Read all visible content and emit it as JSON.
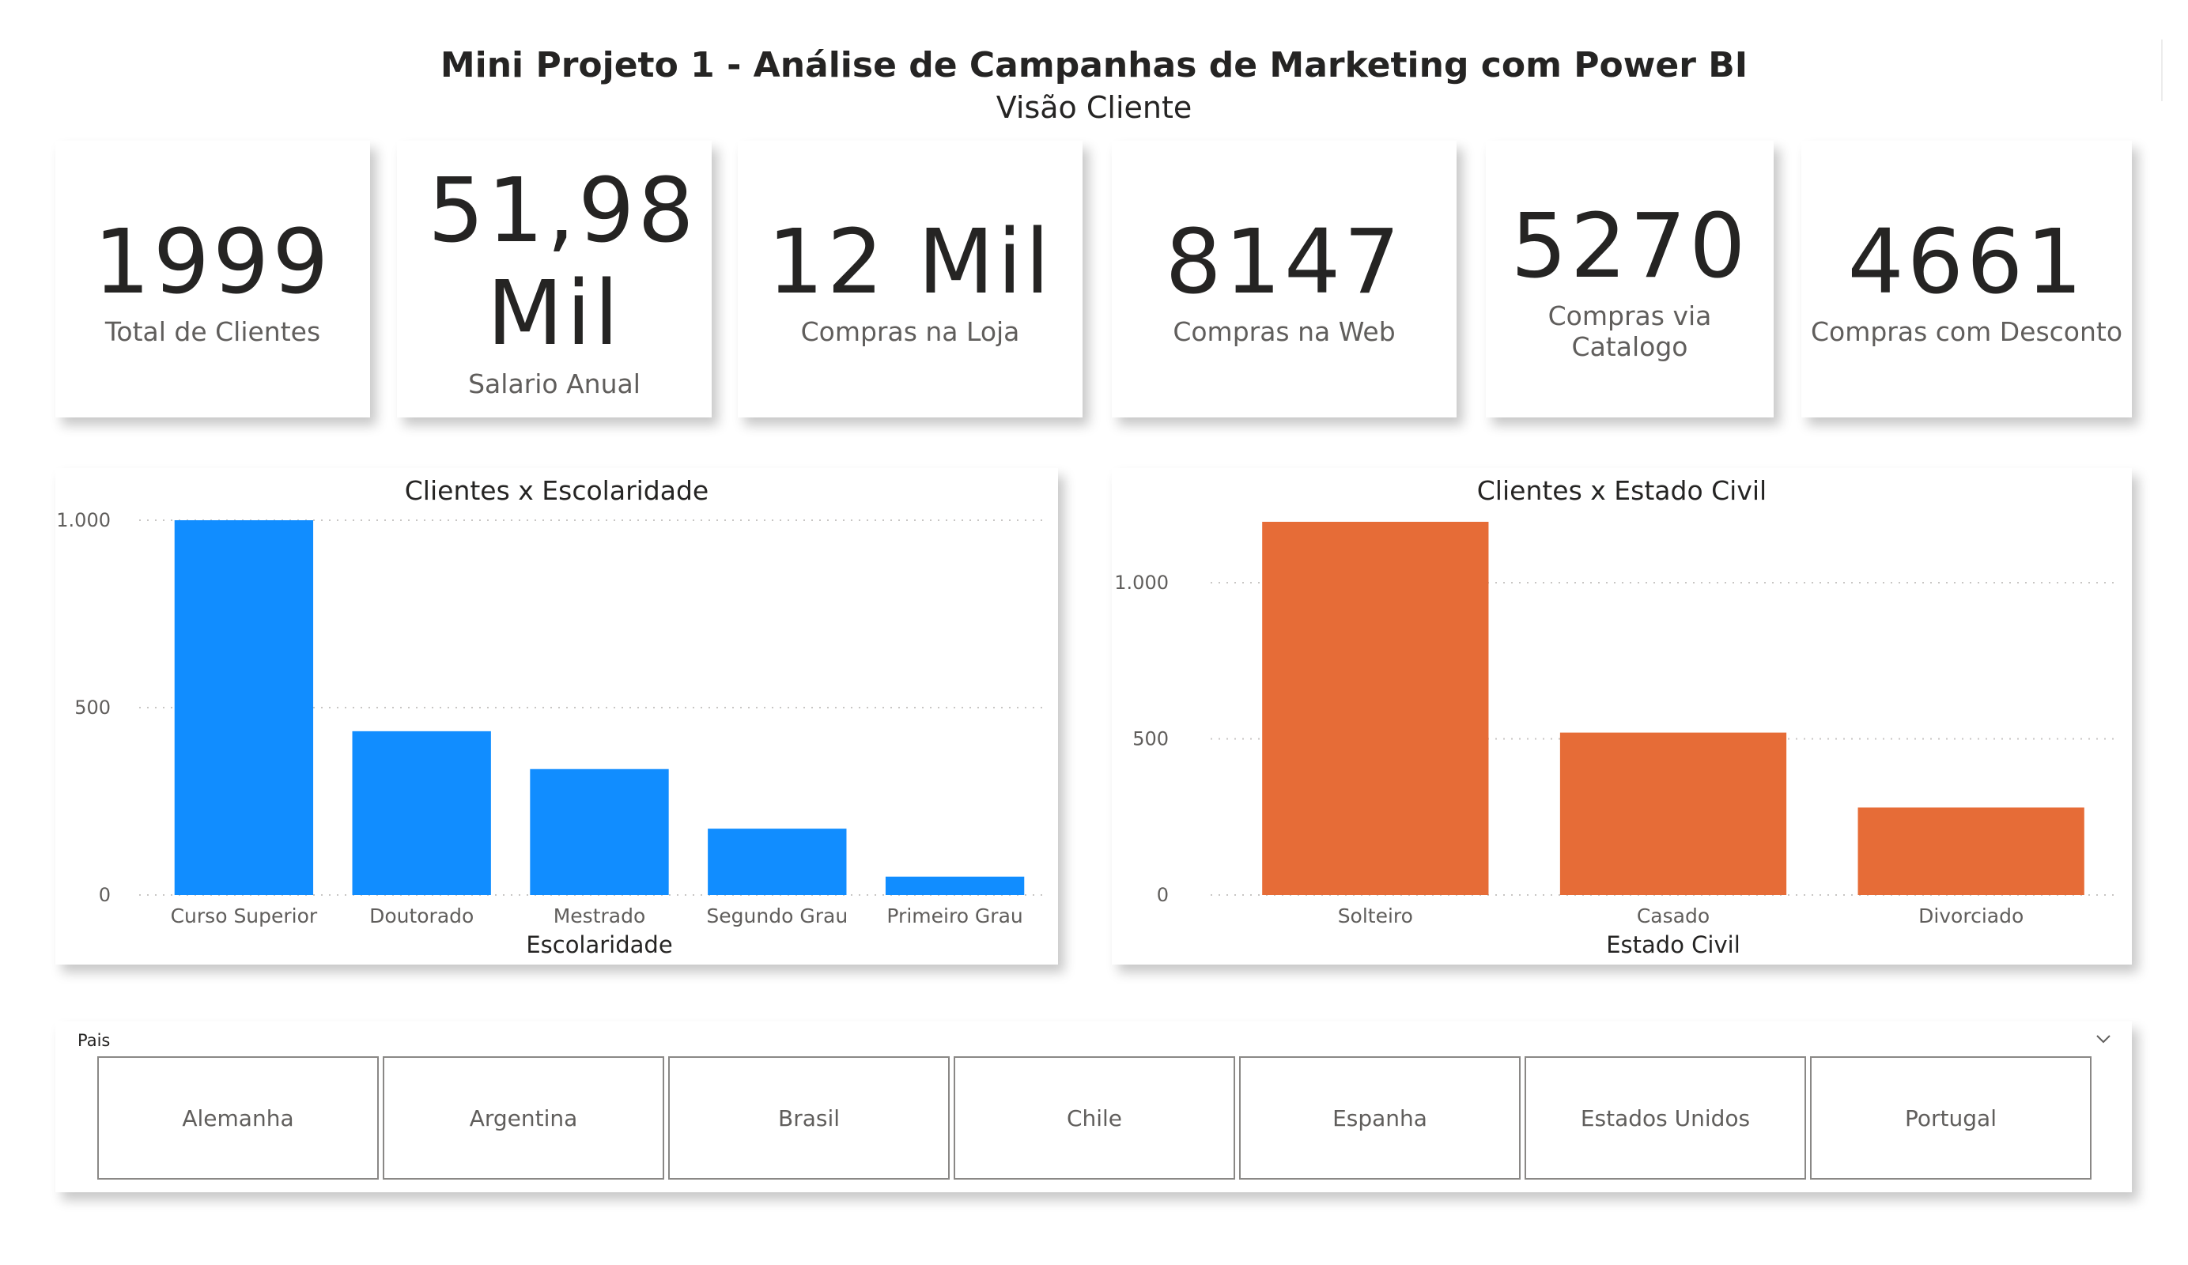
{
  "header": {
    "title": "Mini Projeto 1 - Análise de Campanhas de Marketing com Power BI",
    "subtitle": "Visão Cliente"
  },
  "kpis": [
    {
      "value": "1999",
      "label": "Total de Clientes"
    },
    {
      "value": "51,98 Mil",
      "label": "Salario Anual"
    },
    {
      "value": "12 Mil",
      "label": "Compras na Loja"
    },
    {
      "value": "8147",
      "label": "Compras na Web"
    },
    {
      "value": "5270",
      "label": "Compras via Catalogo"
    },
    {
      "value": "4661",
      "label": "Compras com Desconto"
    }
  ],
  "chart_data": [
    {
      "type": "bar",
      "title": "Clientes x Escolaridade",
      "categories": [
        "Curso Superior",
        "Doutorado",
        "Mestrado",
        "Segundo Grau",
        "Primeiro Grau"
      ],
      "values": [
        1000,
        437,
        336,
        177,
        49
      ],
      "xlabel": "Escolaridade",
      "ylabel": "",
      "ylim": [
        0,
        1000
      ],
      "yticks": [
        0,
        500,
        1000
      ],
      "ytick_labels": [
        "0",
        "500",
        "1.000"
      ],
      "color": "#118DFF",
      "grid": true
    },
    {
      "type": "bar",
      "title": "Clientes x Estado Civil",
      "categories": [
        "Solteiro",
        "Casado",
        "Divorciado"
      ],
      "values": [
        1195,
        520,
        280
      ],
      "xlabel": "Estado Civil",
      "ylabel": "",
      "ylim": [
        0,
        1200
      ],
      "yticks": [
        0,
        500,
        1000
      ],
      "ytick_labels": [
        "0",
        "500",
        "1.000"
      ],
      "color": "#E66C37",
      "grid": true
    }
  ],
  "slicer": {
    "title": "Pais",
    "icon": "chevron-down-icon",
    "options": [
      "Alemanha",
      "Argentina",
      "Brasil",
      "Chile",
      "Espanha",
      "Estados Unidos",
      "Portugal"
    ]
  }
}
